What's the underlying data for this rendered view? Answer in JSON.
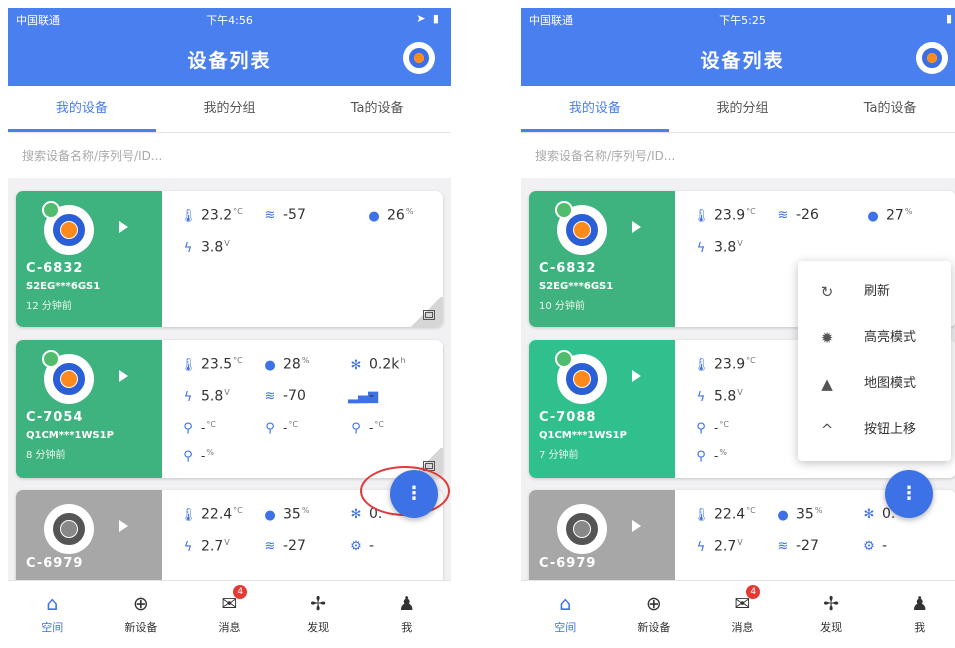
{
  "colors": {
    "primary": "#4a7ff0",
    "online": "#3fb37f",
    "offline": "#a7a7a7",
    "accent": "#ff8a1c",
    "badge": "#e53935",
    "highlight": "#e23a3a"
  },
  "screens": [
    {
      "status": {
        "carrier": "中国联通",
        "time": "下午4:56"
      },
      "nav": {
        "title": "设备列表"
      },
      "tabs": [
        "我的设备",
        "我的分组",
        "Ta的设备"
      ],
      "search": {
        "placeholder": "搜索设备名称/序列号/ID..."
      },
      "devices": [
        {
          "name": "C-6832",
          "serial": "S2EG***6GS1",
          "time": "12 分钟前",
          "status": "online",
          "temp": "23.2",
          "temp_unit": "°C",
          "wifi": "-57",
          "humidity": "26",
          "humidity_unit": "%",
          "voltage": "3.8",
          "voltage_unit": "V"
        },
        {
          "name": "C-7054",
          "serial": "Q1CM***1WS1P",
          "time": "8 分钟前",
          "status": "online",
          "temp": "23.5",
          "temp_unit": "°C",
          "humidity": "28",
          "humidity_unit": "%",
          "fan": "0.2k",
          "fan_unit": "h",
          "voltage": "5.8",
          "voltage_unit": "V",
          "wifi": "-70",
          "signal": "-",
          "probe1": "-",
          "probe1_unit": "°C",
          "probe2": "-",
          "probe2_unit": "°C",
          "probe3": "-",
          "probe3_unit": "°C",
          "probe4": "-",
          "probe4_unit": "%"
        },
        {
          "name": "C-6979",
          "serial": "",
          "time": "",
          "status": "offline",
          "temp": "22.4",
          "temp_unit": "°C",
          "humidity": "35",
          "humidity_unit": "%",
          "fan": "0.",
          "voltage": "2.7",
          "voltage_unit": "V",
          "wifi": "-27",
          "extra": "-"
        }
      ],
      "fab": {
        "label": "⋮"
      },
      "tabbar": [
        {
          "label": "空间",
          "icon": "home-icon"
        },
        {
          "label": "新设备",
          "icon": "add-circle-icon"
        },
        {
          "label": "消息",
          "icon": "mail-icon",
          "badge": "4"
        },
        {
          "label": "发现",
          "icon": "fan-icon"
        },
        {
          "label": "我",
          "icon": "person-icon"
        }
      ]
    },
    {
      "status": {
        "carrier": "中国联通",
        "time": "下午5:25"
      },
      "nav": {
        "title": "设备列表"
      },
      "tabs": [
        "我的设备",
        "我的分组",
        "Ta的设备"
      ],
      "search": {
        "placeholder": "搜索设备名称/序列号/ID..."
      },
      "devices": [
        {
          "name": "C-6832",
          "serial": "S2EG***6GS1",
          "time": "10 分钟前",
          "status": "online",
          "temp": "23.9",
          "temp_unit": "°C",
          "wifi": "-26",
          "humidity": "27",
          "humidity_unit": "%",
          "voltage": "3.8",
          "voltage_unit": "V"
        },
        {
          "name": "C-7088",
          "serial": "Q1CM***1WS1P",
          "time": "7 分钟前",
          "status": "online",
          "temp": "23.9",
          "temp_unit": "°C",
          "voltage": "5.8",
          "voltage_unit": "V",
          "probe1": "-",
          "probe1_unit": "°C",
          "probe4": "-",
          "probe4_unit": "%"
        },
        {
          "name": "C-6979",
          "serial": "",
          "time": "",
          "status": "offline",
          "temp": "22.4",
          "temp_unit": "°C",
          "humidity": "35",
          "humidity_unit": "%",
          "fan": "0.",
          "voltage": "2.7",
          "voltage_unit": "V",
          "wifi": "-27",
          "extra": "-"
        }
      ],
      "menu": [
        {
          "label": "刷新",
          "icon": "refresh-icon"
        },
        {
          "label": "高亮模式",
          "icon": "highlight-mode-icon"
        },
        {
          "label": "地图模式",
          "icon": "map-mode-icon"
        },
        {
          "label": "按钮上移",
          "icon": "chevron-up-icon"
        }
      ],
      "fab": {
        "label": "⋮"
      },
      "tabbar": [
        {
          "label": "空间",
          "icon": "home-icon"
        },
        {
          "label": "新设备",
          "icon": "add-circle-icon"
        },
        {
          "label": "消息",
          "icon": "mail-icon",
          "badge": "4"
        },
        {
          "label": "发现",
          "icon": "fan-icon"
        },
        {
          "label": "我",
          "icon": "person-icon"
        }
      ]
    }
  ]
}
